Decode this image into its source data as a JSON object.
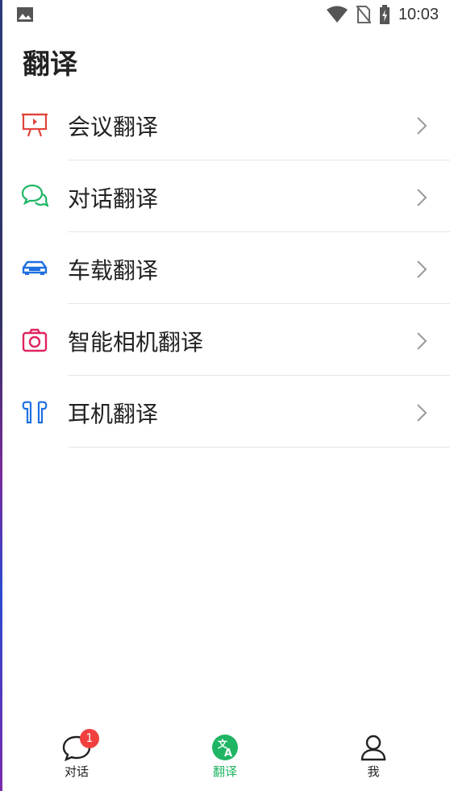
{
  "status_bar": {
    "time": "10:03"
  },
  "header": {
    "title": "翻译"
  },
  "list": [
    {
      "label": "会议翻译",
      "icon": "presentation-icon",
      "color": "#e0443a"
    },
    {
      "label": "对话翻译",
      "icon": "chat-bubbles-icon",
      "color": "#1fb564"
    },
    {
      "label": "车载翻译",
      "icon": "car-icon",
      "color": "#1e6fe0"
    },
    {
      "label": "智能相机翻译",
      "icon": "camera-icon",
      "color": "#e0245e"
    },
    {
      "label": "耳机翻译",
      "icon": "earbuds-icon",
      "color": "#1e6fe0"
    }
  ],
  "bottom_nav": {
    "tabs": [
      {
        "label": "对话",
        "icon": "chat-icon",
        "badge": "1"
      },
      {
        "label": "翻译",
        "icon": "translate-icon",
        "active": true
      },
      {
        "label": "我",
        "icon": "person-icon"
      }
    ],
    "active_color": "#1fb564",
    "badge_color": "#f24040"
  }
}
